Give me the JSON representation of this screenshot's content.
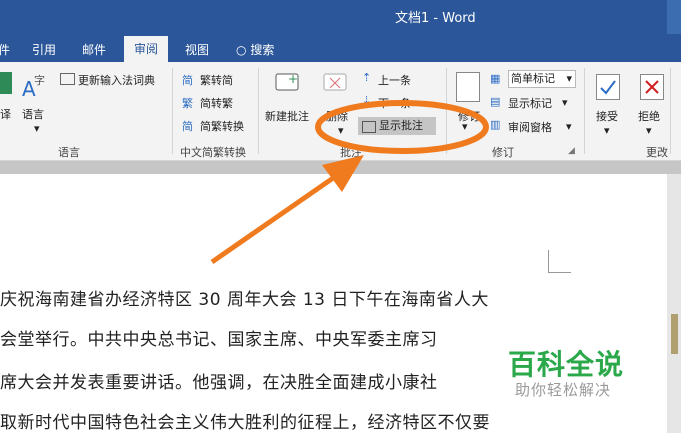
{
  "window": {
    "title": "文档1  -  Word"
  },
  "tabs": {
    "first": "件",
    "references": "引用",
    "mailings": "邮件",
    "review": "审阅",
    "view": "视图",
    "tell_me": "搜索"
  },
  "ribbon": {
    "language": {
      "first_label": "译",
      "language_label": "语言",
      "update_ime": "更新输入法词典",
      "group_label": "语言"
    },
    "chinese": {
      "to_traditional": "繁转简",
      "to_simplified": "简转繁",
      "convert": "简繁转换",
      "group_label": "中文简繁转换"
    },
    "comments": {
      "new_comment": "新建批注",
      "delete": "删除",
      "previous": "上一条",
      "next": "下一条",
      "show_comments": "显示批注",
      "group_label": "批注"
    },
    "tracking": {
      "track": "修订",
      "simple_markup": "简单标记",
      "show_markup": "显示标记",
      "reviewing_pane": "审阅窗格",
      "group_label": "修订"
    },
    "changes": {
      "accept": "接受",
      "reject": "拒绝",
      "group_label": "更改"
    }
  },
  "document": {
    "lines": [
      "庆祝海南建省办经济特区 30 周年大会 13 日下午在海南省人大",
      "会堂举行。中共中央总书记、国家主席、中央军委主席习",
      "席大会并发表重要讲话。他强调，在决胜全面建成小康社",
      "取新时代中国特色社会主义伟大胜利的征程上，经济特区不仅要"
    ]
  },
  "watermark": {
    "brand": "百科全说",
    "slogan": "助你轻松解决"
  },
  "colors": {
    "title_bar": "#2b579a",
    "highlight": "#f07a1e",
    "watermark_green": "#2aa84a"
  }
}
